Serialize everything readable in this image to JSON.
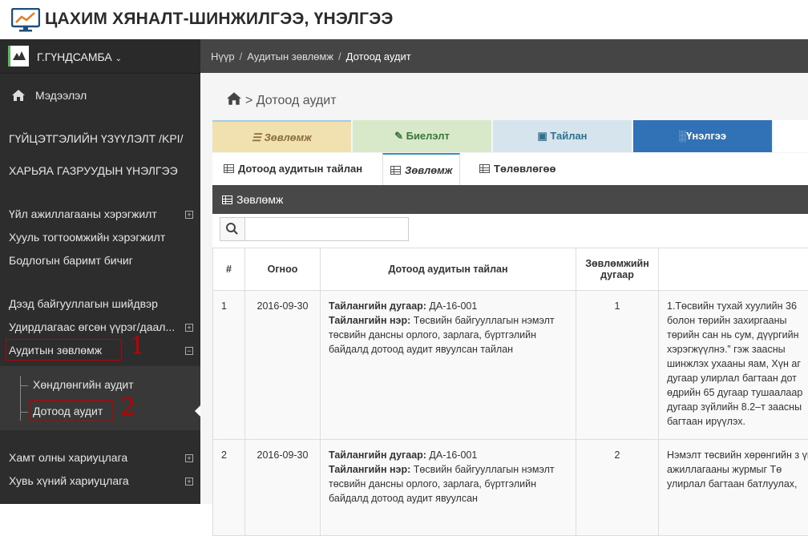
{
  "header": {
    "title": "ЦАХИМ ХЯНАЛТ-ШИНЖИЛГЭЭ, ҮНЭЛГЭЭ"
  },
  "user": {
    "name": "Г.ГҮНДСАМБА"
  },
  "sidebar": {
    "home": "Мэдээлэл",
    "items": [
      "ГҮЙЦЭТГЭЛИЙН ҮЗҮҮЛЭЛТ /KPI/",
      "ХАРЬЯА ГАЗРУУДЫН ҮНЭЛГЭЭ",
      "Үйл ажиллагааны хэрэгжилт",
      "Хууль тогтоомжийн хэрэгжилт",
      "Бодлогын баримт бичиг",
      "Дээд байгууллагын шийдвэр",
      "Удирдлагаас өгсөн үүрэг/даал...",
      "Аудитын зөвлөмж",
      "Хамт олны хариуцлага",
      "Хувь хүний хариуцлага"
    ],
    "sub": [
      "Хөндлөнгийн аудит",
      "Дотоод аудит"
    ],
    "markers": [
      "1",
      "2"
    ]
  },
  "breadcrumb": {
    "items": [
      "Нүүр",
      "Аудитын зөвлөмж"
    ],
    "current": "Дотоод аудит",
    "sep": "/"
  },
  "page": {
    "title": "> Дотоод аудит"
  },
  "bigtabs": [
    "Зөвлөмж",
    "Биелэлт",
    "Тайлан",
    "Үнэлгээ"
  ],
  "smalltabs": [
    "Дотоод аудитын тайлан",
    "Зөвлөмж",
    "Төлөвлөгөө"
  ],
  "panel": {
    "title": "Зөвлөмж"
  },
  "search": {
    "placeholder": ""
  },
  "table": {
    "headers": [
      "#",
      "Огноо",
      "Дотоод аудитын тайлан",
      "Зөвлөмжийн дугаар",
      ""
    ],
    "label_num": "Тайлангийн дугаар:",
    "label_name": "Тайлангийн нэр:",
    "rows": [
      {
        "n": "1",
        "date": "2016-09-30",
        "num": " ДА-16-001",
        "name": " Төсвийн байгууллагын нэмэлт төсвийн дансны орлого, зарлага, бүртгэлийн байдалд дотоод аудит явуулсан тайлан",
        "rec": "1",
        "text": "1.Төсвийн тухай хуулийн 36 болон төрийн захиргааны төрийн сан нь сум, дүүргийн хэрэгжүүлнэ.” гэж заасны шинжлэх ухааны яам, Хүн аг дугаар улирлал багтаан дот өдрийн 65 дугаар тушаалаар дугаар зүйлийн 8.2–т заасны багтаан ирүүлэх."
      },
      {
        "n": "2",
        "date": "2016-09-30",
        "num": " ДА-16-001",
        "name": " Төсвийн байгууллагын нэмэлт төсвийн дансны орлого, зарлага, бүртгэлийн байдалд дотоод аудит явуулсан",
        "rec": "2",
        "text": "Нэмэлт төсвийн хөрөнгийн з үйл ажиллагааны журмыг Тө улирлал багтаан батлуулах,"
      }
    ]
  }
}
